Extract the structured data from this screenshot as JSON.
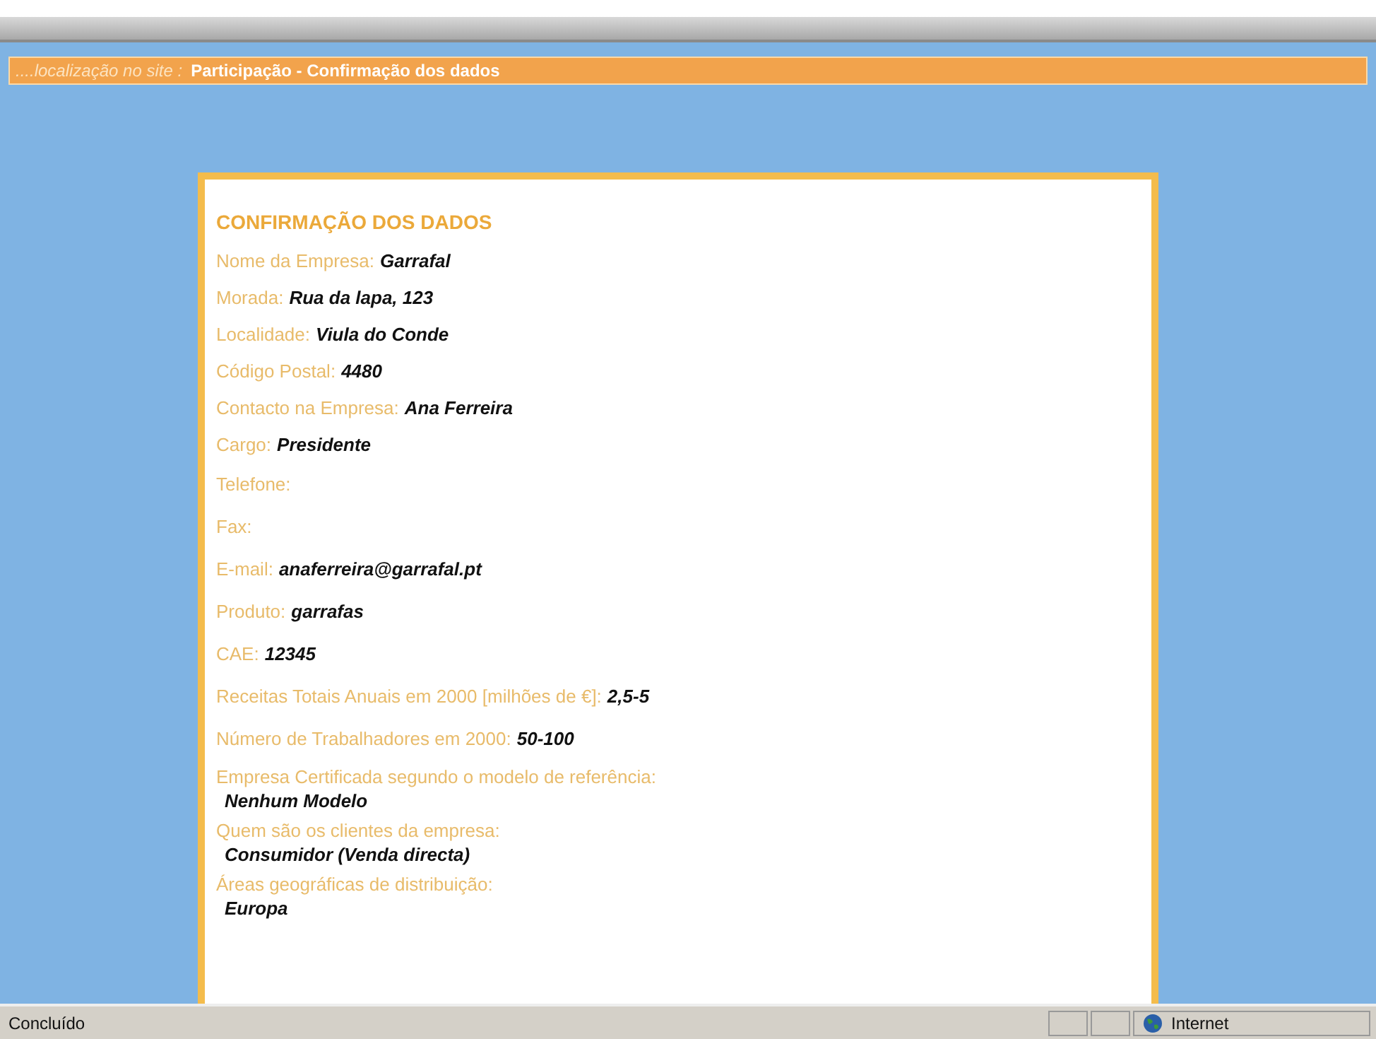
{
  "breadcrumb": {
    "location_label": "....localização no site :",
    "page_title": "Participação - Confirmação dos dados"
  },
  "card": {
    "heading": "CONFIRMAÇÃO DOS DADOS",
    "fields": [
      {
        "kind": "inline",
        "label": "Nome da Empresa:",
        "value": "Garrafal"
      },
      {
        "kind": "inline",
        "label": "Morada:",
        "value": "Rua da lapa, 123"
      },
      {
        "kind": "inline",
        "label": "Localidade:",
        "value": "Viula do Conde"
      },
      {
        "kind": "inline",
        "label": "Código Postal:",
        "value": "4480"
      },
      {
        "kind": "inline",
        "label": "Contacto na Empresa:",
        "value": "Ana Ferreira"
      },
      {
        "kind": "inline",
        "label": "Cargo:",
        "value": "Presidente"
      },
      {
        "kind": "inline",
        "label": "Telefone:"
      },
      {
        "kind": "inline",
        "label": "Fax:"
      },
      {
        "kind": "inline",
        "label": "E-mail:",
        "value": "anaferreira@garrafal.pt"
      },
      {
        "kind": "inline",
        "label": "Produto:",
        "value": "garrafas"
      },
      {
        "kind": "inline",
        "label": "CAE:",
        "value": "12345"
      },
      {
        "kind": "inline",
        "label": "Receitas Totais Anuais em 2000 [milhões de €]:",
        "value": "2,5-5"
      },
      {
        "kind": "inline",
        "label": "Número de Trabalhadores em 2000:",
        "value": "50-100"
      },
      {
        "kind": "block",
        "label": "Empresa Certificada segundo o modelo de referência:",
        "value": "Nenhum Modelo"
      },
      {
        "kind": "block",
        "label": "Quem são os clientes da empresa:",
        "value": "Consumidor (Venda directa)"
      },
      {
        "kind": "block",
        "label": "Áreas geográficas de distribuição:",
        "value": "Europa"
      }
    ]
  },
  "status_bar": {
    "text": "Concluído",
    "zone": "Internet"
  }
}
